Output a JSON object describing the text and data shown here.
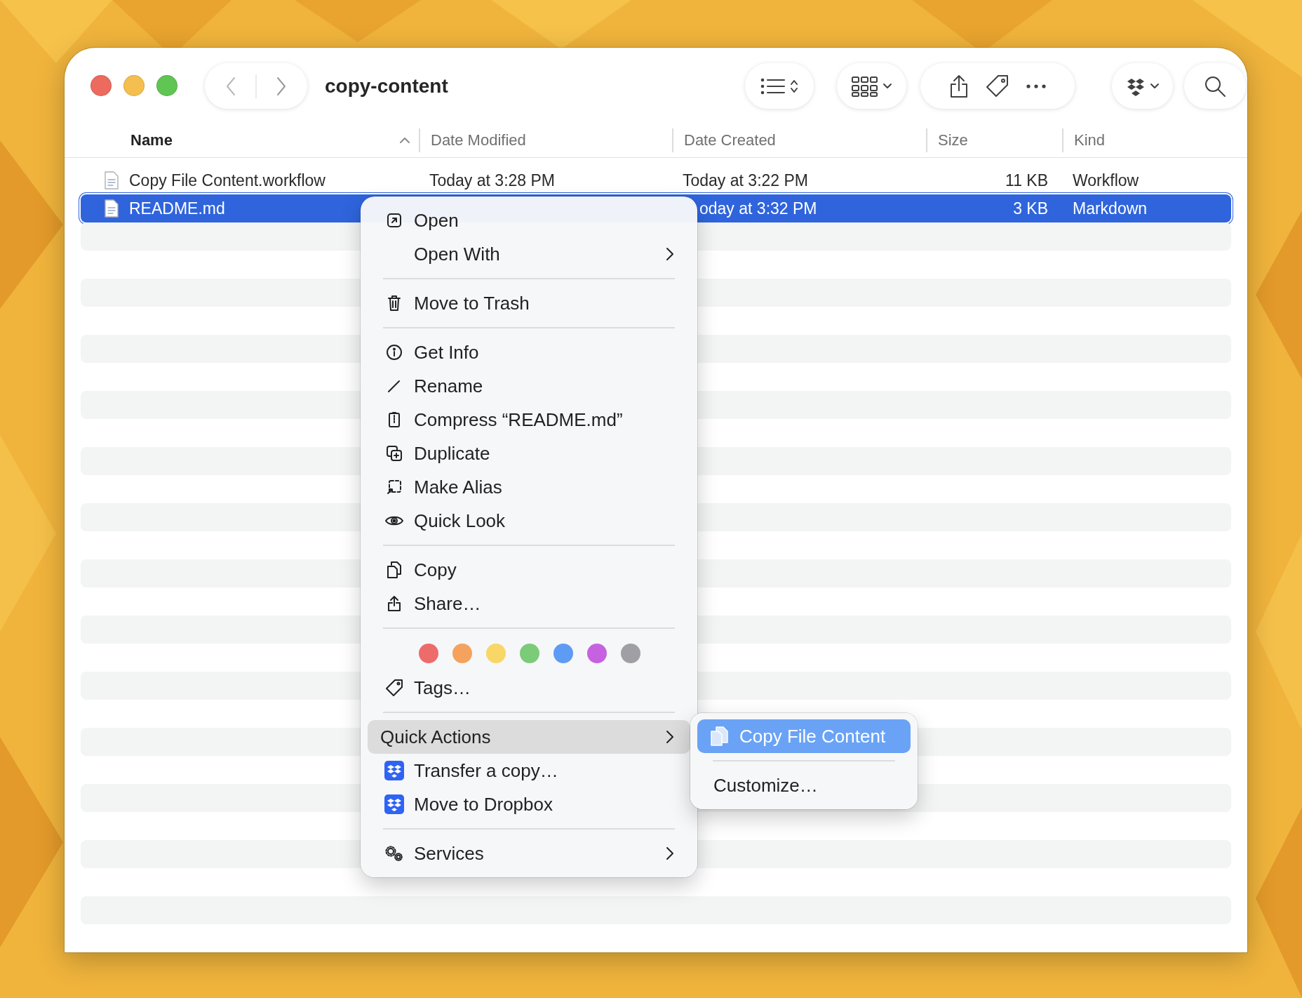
{
  "window": {
    "title": "copy-content"
  },
  "columns": [
    {
      "label": "Name",
      "sorted": true
    },
    {
      "label": "Date Modified",
      "sorted": false
    },
    {
      "label": "Date Created",
      "sorted": false
    },
    {
      "label": "Size",
      "sorted": false
    },
    {
      "label": "Kind",
      "sorted": false
    }
  ],
  "files": [
    {
      "name": "Copy File Content.workflow",
      "modified": "Today at 3:28 PM",
      "created": "Today at 3:22 PM",
      "size": "11 KB",
      "kind": "Workflow",
      "selected": false
    },
    {
      "name": "README.md",
      "created": "oday at 3:32 PM",
      "size": "3 KB",
      "kind": "Markdown",
      "selected": true
    }
  ],
  "context_menu": [
    {
      "kind": "item",
      "label": "Open",
      "submenu": false,
      "selected": false
    },
    {
      "kind": "item",
      "label": "Open With",
      "submenu": true,
      "selected": false
    },
    {
      "kind": "separator"
    },
    {
      "kind": "item",
      "label": "Move to Trash",
      "submenu": false,
      "selected": false
    },
    {
      "kind": "separator"
    },
    {
      "kind": "item",
      "label": "Get Info",
      "submenu": false,
      "selected": false
    },
    {
      "kind": "item",
      "label": "Rename",
      "submenu": false,
      "selected": false
    },
    {
      "kind": "item",
      "label": "Compress “README.md”",
      "submenu": false,
      "selected": false
    },
    {
      "kind": "item",
      "label": "Duplicate",
      "submenu": false,
      "selected": false
    },
    {
      "kind": "item",
      "label": "Make Alias",
      "submenu": false,
      "selected": false
    },
    {
      "kind": "item",
      "label": "Quick Look",
      "submenu": false,
      "selected": false
    },
    {
      "kind": "separator"
    },
    {
      "kind": "item",
      "label": "Copy",
      "submenu": false,
      "selected": false
    },
    {
      "kind": "item",
      "label": "Share…",
      "submenu": false,
      "selected": false
    },
    {
      "kind": "separator"
    },
    {
      "kind": "tags",
      "colors": [
        {
          "color": "#ee6b6b"
        },
        {
          "color": "#f4a25d"
        },
        {
          "color": "#f8d767"
        },
        {
          "color": "#7ccb78"
        },
        {
          "color": "#5e9bf5"
        },
        {
          "color": "#c662e0"
        },
        {
          "color": "#a0a0a4"
        }
      ]
    },
    {
      "kind": "item",
      "label": "Tags…",
      "submenu": false,
      "selected": false
    },
    {
      "kind": "separator"
    },
    {
      "kind": "item",
      "label": "Quick Actions",
      "submenu": true,
      "selected": true
    },
    {
      "kind": "item",
      "label": "Transfer a copy…",
      "submenu": false,
      "selected": false
    },
    {
      "kind": "item",
      "label": "Move to Dropbox",
      "submenu": false,
      "selected": false
    },
    {
      "kind": "separator"
    },
    {
      "kind": "item",
      "label": "Services",
      "submenu": true,
      "selected": false
    }
  ],
  "quick_actions_menu": [
    {
      "kind": "item",
      "label": "Copy File Content",
      "selected": true
    },
    {
      "kind": "separator"
    },
    {
      "kind": "item",
      "label": "Customize…",
      "selected": false
    }
  ]
}
